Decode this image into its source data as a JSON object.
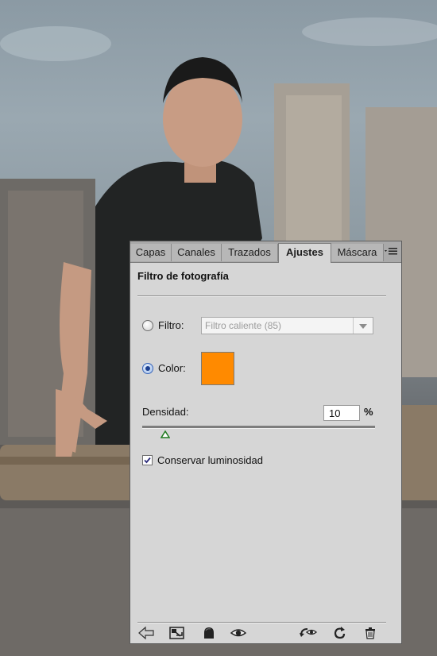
{
  "panel": {
    "tabs": [
      {
        "label": "Capas"
      },
      {
        "label": "Canales"
      },
      {
        "label": "Trazados"
      },
      {
        "label": "Ajustes",
        "active": true
      },
      {
        "label": "Máscara"
      }
    ],
    "title": "Filtro de fotografía",
    "filter": {
      "label": "Filtro:",
      "selected": "Filtro caliente (85)"
    },
    "color": {
      "label": "Color:",
      "swatch": "#ff8a00"
    },
    "density": {
      "label": "Densidad:",
      "value": "10",
      "unit": "%",
      "level": 0.1
    },
    "preserve_luminosity": {
      "label": "Conservar luminosidad",
      "checked": true
    },
    "footer_icons": [
      "back-arrow-icon",
      "resize-panel-icon",
      "clip-to-layer-icon",
      "visibility-eye-icon",
      "view-previous-state-icon",
      "reset-icon",
      "trash-icon"
    ]
  }
}
